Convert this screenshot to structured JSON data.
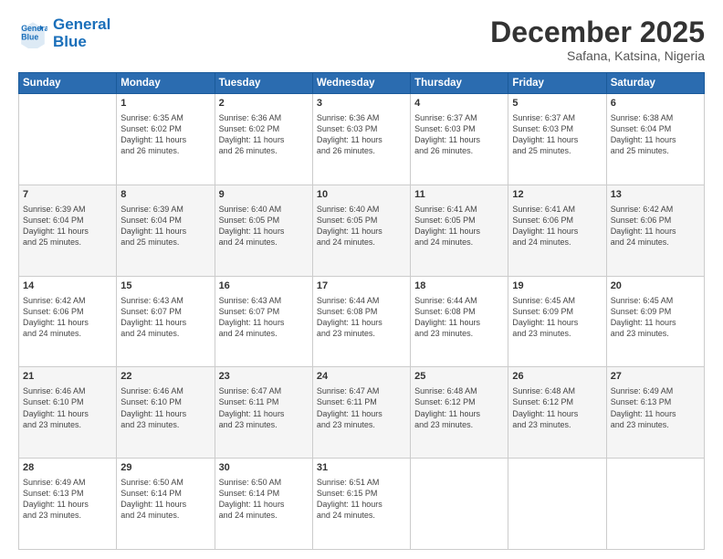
{
  "logo": {
    "line1": "General",
    "line2": "Blue"
  },
  "header": {
    "month": "December 2025",
    "location": "Safana, Katsina, Nigeria"
  },
  "weekdays": [
    "Sunday",
    "Monday",
    "Tuesday",
    "Wednesday",
    "Thursday",
    "Friday",
    "Saturday"
  ],
  "weeks": [
    [
      {
        "day": "",
        "sunrise": "",
        "sunset": "",
        "daylight": ""
      },
      {
        "day": "1",
        "sunrise": "6:35 AM",
        "sunset": "6:02 PM",
        "daylight": "11 hours and 26 minutes."
      },
      {
        "day": "2",
        "sunrise": "6:36 AM",
        "sunset": "6:02 PM",
        "daylight": "11 hours and 26 minutes."
      },
      {
        "day": "3",
        "sunrise": "6:36 AM",
        "sunset": "6:03 PM",
        "daylight": "11 hours and 26 minutes."
      },
      {
        "day": "4",
        "sunrise": "6:37 AM",
        "sunset": "6:03 PM",
        "daylight": "11 hours and 26 minutes."
      },
      {
        "day": "5",
        "sunrise": "6:37 AM",
        "sunset": "6:03 PM",
        "daylight": "11 hours and 25 minutes."
      },
      {
        "day": "6",
        "sunrise": "6:38 AM",
        "sunset": "6:04 PM",
        "daylight": "11 hours and 25 minutes."
      }
    ],
    [
      {
        "day": "7",
        "sunrise": "6:39 AM",
        "sunset": "6:04 PM",
        "daylight": "11 hours and 25 minutes."
      },
      {
        "day": "8",
        "sunrise": "6:39 AM",
        "sunset": "6:04 PM",
        "daylight": "11 hours and 25 minutes."
      },
      {
        "day": "9",
        "sunrise": "6:40 AM",
        "sunset": "6:05 PM",
        "daylight": "11 hours and 24 minutes."
      },
      {
        "day": "10",
        "sunrise": "6:40 AM",
        "sunset": "6:05 PM",
        "daylight": "11 hours and 24 minutes."
      },
      {
        "day": "11",
        "sunrise": "6:41 AM",
        "sunset": "6:05 PM",
        "daylight": "11 hours and 24 minutes."
      },
      {
        "day": "12",
        "sunrise": "6:41 AM",
        "sunset": "6:06 PM",
        "daylight": "11 hours and 24 minutes."
      },
      {
        "day": "13",
        "sunrise": "6:42 AM",
        "sunset": "6:06 PM",
        "daylight": "11 hours and 24 minutes."
      }
    ],
    [
      {
        "day": "14",
        "sunrise": "6:42 AM",
        "sunset": "6:06 PM",
        "daylight": "11 hours and 24 minutes."
      },
      {
        "day": "15",
        "sunrise": "6:43 AM",
        "sunset": "6:07 PM",
        "daylight": "11 hours and 24 minutes."
      },
      {
        "day": "16",
        "sunrise": "6:43 AM",
        "sunset": "6:07 PM",
        "daylight": "11 hours and 24 minutes."
      },
      {
        "day": "17",
        "sunrise": "6:44 AM",
        "sunset": "6:08 PM",
        "daylight": "11 hours and 23 minutes."
      },
      {
        "day": "18",
        "sunrise": "6:44 AM",
        "sunset": "6:08 PM",
        "daylight": "11 hours and 23 minutes."
      },
      {
        "day": "19",
        "sunrise": "6:45 AM",
        "sunset": "6:09 PM",
        "daylight": "11 hours and 23 minutes."
      },
      {
        "day": "20",
        "sunrise": "6:45 AM",
        "sunset": "6:09 PM",
        "daylight": "11 hours and 23 minutes."
      }
    ],
    [
      {
        "day": "21",
        "sunrise": "6:46 AM",
        "sunset": "6:10 PM",
        "daylight": "11 hours and 23 minutes."
      },
      {
        "day": "22",
        "sunrise": "6:46 AM",
        "sunset": "6:10 PM",
        "daylight": "11 hours and 23 minutes."
      },
      {
        "day": "23",
        "sunrise": "6:47 AM",
        "sunset": "6:11 PM",
        "daylight": "11 hours and 23 minutes."
      },
      {
        "day": "24",
        "sunrise": "6:47 AM",
        "sunset": "6:11 PM",
        "daylight": "11 hours and 23 minutes."
      },
      {
        "day": "25",
        "sunrise": "6:48 AM",
        "sunset": "6:12 PM",
        "daylight": "11 hours and 23 minutes."
      },
      {
        "day": "26",
        "sunrise": "6:48 AM",
        "sunset": "6:12 PM",
        "daylight": "11 hours and 23 minutes."
      },
      {
        "day": "27",
        "sunrise": "6:49 AM",
        "sunset": "6:13 PM",
        "daylight": "11 hours and 23 minutes."
      }
    ],
    [
      {
        "day": "28",
        "sunrise": "6:49 AM",
        "sunset": "6:13 PM",
        "daylight": "11 hours and 23 minutes."
      },
      {
        "day": "29",
        "sunrise": "6:50 AM",
        "sunset": "6:14 PM",
        "daylight": "11 hours and 24 minutes."
      },
      {
        "day": "30",
        "sunrise": "6:50 AM",
        "sunset": "6:14 PM",
        "daylight": "11 hours and 24 minutes."
      },
      {
        "day": "31",
        "sunrise": "6:51 AM",
        "sunset": "6:15 PM",
        "daylight": "11 hours and 24 minutes."
      },
      {
        "day": "",
        "sunrise": "",
        "sunset": "",
        "daylight": ""
      },
      {
        "day": "",
        "sunrise": "",
        "sunset": "",
        "daylight": ""
      },
      {
        "day": "",
        "sunrise": "",
        "sunset": "",
        "daylight": ""
      }
    ]
  ]
}
